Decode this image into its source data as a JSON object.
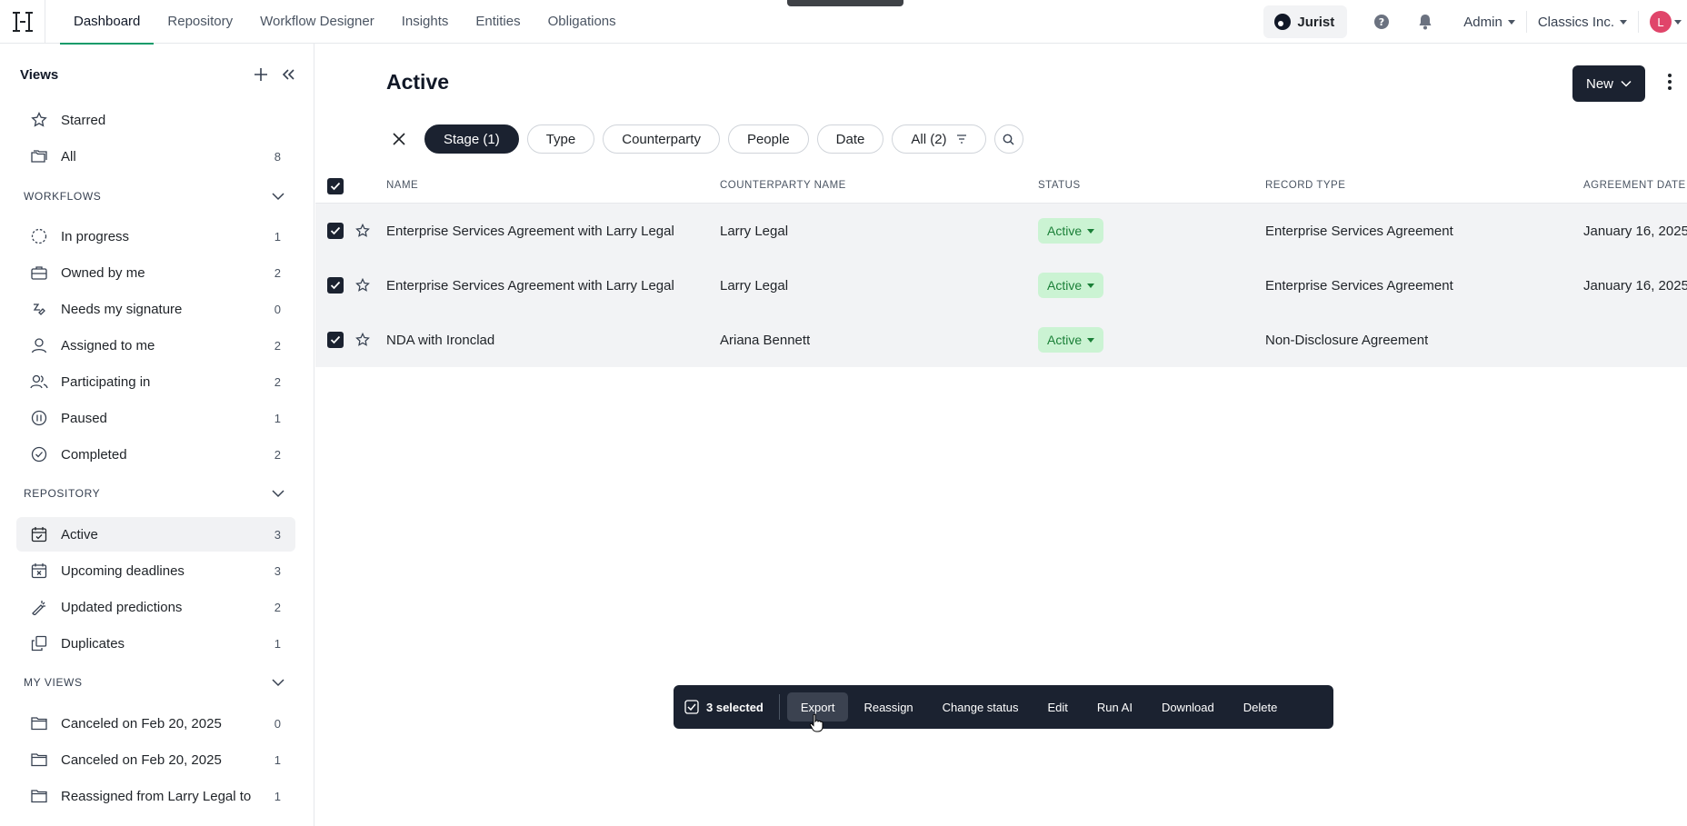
{
  "nav": {
    "items": [
      "Dashboard",
      "Repository",
      "Workflow Designer",
      "Insights",
      "Entities",
      "Obligations"
    ],
    "active": "Dashboard"
  },
  "topbar": {
    "jurist_label": "Jurist",
    "admin_label": "Admin",
    "org_label": "Classics Inc.",
    "avatar_initial": "L"
  },
  "sidebar": {
    "title": "Views",
    "top_items": [
      {
        "label": "Starred",
        "count": "",
        "icon": "star-icon"
      },
      {
        "label": "All",
        "count": "8",
        "icon": "folder-stack-icon"
      }
    ],
    "workflows_title": "WORKFLOWS",
    "workflows": [
      {
        "label": "In progress",
        "count": "1",
        "icon": "dashed-circle-icon"
      },
      {
        "label": "Owned by me",
        "count": "2",
        "icon": "briefcase-icon"
      },
      {
        "label": "Needs my signature",
        "count": "0",
        "icon": "signature-icon"
      },
      {
        "label": "Assigned to me",
        "count": "2",
        "icon": "user-icon"
      },
      {
        "label": "Participating in",
        "count": "2",
        "icon": "users-icon"
      },
      {
        "label": "Paused",
        "count": "1",
        "icon": "pause-circle-icon"
      },
      {
        "label": "Completed",
        "count": "2",
        "icon": "check-circle-icon"
      }
    ],
    "repository_title": "REPOSITORY",
    "repository": [
      {
        "label": "Active",
        "count": "3",
        "icon": "calendar-check-icon",
        "selected": true
      },
      {
        "label": "Upcoming deadlines",
        "count": "3",
        "icon": "calendar-x-icon"
      },
      {
        "label": "Updated predictions",
        "count": "2",
        "icon": "magic-wand-icon"
      },
      {
        "label": "Duplicates",
        "count": "1",
        "icon": "copy-icon"
      }
    ],
    "myviews_title": "MY VIEWS",
    "myviews": [
      {
        "label": "Canceled on Feb 20, 2025",
        "count": "0",
        "icon": "folder-icon"
      },
      {
        "label": "Canceled on Feb 20, 2025",
        "count": "1",
        "icon": "folder-icon"
      },
      {
        "label": "Reassigned from Larry Legal to",
        "count": "1",
        "icon": "folder-icon"
      }
    ]
  },
  "main": {
    "title": "Active",
    "new_label": "New",
    "filters": [
      "Stage (1)",
      "Type",
      "Counterparty",
      "People",
      "Date",
      "All (2)"
    ],
    "columns": [
      "NAME",
      "COUNTERPARTY NAME",
      "STATUS",
      "RECORD TYPE",
      "AGREEMENT DATE"
    ],
    "rows": [
      {
        "name": "Enterprise Services Agreement with Larry Legal",
        "counterparty": "Larry Legal",
        "status": "Active",
        "record_type": "Enterprise Services Agreement",
        "agreement_date": "January 16, 2025"
      },
      {
        "name": "Enterprise Services Agreement with Larry Legal",
        "counterparty": "Larry Legal",
        "status": "Active",
        "record_type": "Enterprise Services Agreement",
        "agreement_date": "January 16, 2025"
      },
      {
        "name": "NDA with Ironclad",
        "counterparty": "Ariana Bennett",
        "status": "Active",
        "record_type": "Non-Disclosure Agreement",
        "agreement_date": ""
      }
    ]
  },
  "actionbar": {
    "selected_label": "3 selected",
    "actions": [
      "Export",
      "Reassign",
      "Change status",
      "Edit",
      "Run AI",
      "Download",
      "Delete"
    ]
  },
  "colors": {
    "accent": "#0f9b6a",
    "dark": "#1b2230",
    "status_bg": "#cbf3d3",
    "status_fg": "#1a7f37",
    "avatar": "#e0456a"
  }
}
